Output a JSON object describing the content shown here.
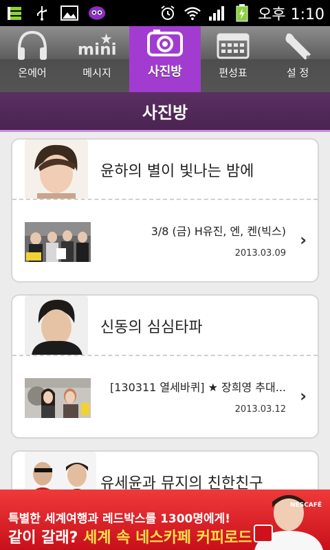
{
  "status": {
    "time": "오후 1:10"
  },
  "tabs": [
    {
      "label": "온에어",
      "icon": "headphones-icon"
    },
    {
      "label": "메시지",
      "icon": "mini-logo-icon"
    },
    {
      "label": "사진방",
      "icon": "camera-icon",
      "active": true
    },
    {
      "label": "편성표",
      "icon": "calendar-icon"
    },
    {
      "label": "설 정",
      "icon": "wrench-icon"
    }
  ],
  "page": {
    "title": "사진방"
  },
  "programs": [
    {
      "title": "윤하의 별이 빛나는 밤에",
      "entry": "3/8 (금) H유진, 엔, 켄(빅스)",
      "date": "2013.03.09"
    },
    {
      "title": "신동의 심심타파",
      "entry": "[130311 열세바퀴] ★ 장희영 추대...",
      "date": "2013.03.12"
    },
    {
      "title": "유세윤과 뮤지의 친한친구"
    }
  ],
  "ad": {
    "line1": "특별한 세계여행과 레드박스를 1300명에게!",
    "line2a": "같이 갈래? ",
    "line2b": "세계 속 네스카페 커피로드",
    "brand": "NESCAFÉ"
  },
  "colors": {
    "accent": "#a23cd0",
    "titlebar": "#4a2452",
    "ad": "#d81e26"
  }
}
